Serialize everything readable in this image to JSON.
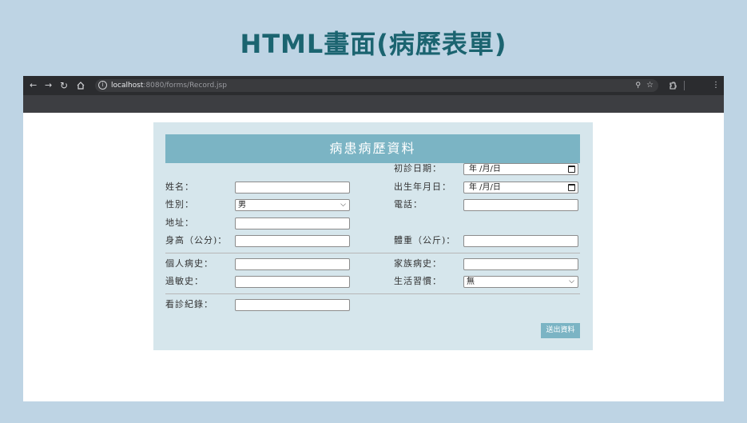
{
  "slide": {
    "title": "HTML畫面(病歷表單)"
  },
  "browser": {
    "url_host": "localhost",
    "url_rest": ":8080/forms/Record.jsp",
    "icons": [
      "back-icon",
      "forward-icon",
      "reload-icon",
      "home-icon",
      "site-info-icon",
      "zoom-icon",
      "star-icon",
      "extensions-icon",
      "menu-icon"
    ]
  },
  "form": {
    "heading": "病患病歷資料",
    "first_visit": {
      "label": "初診日期：",
      "value": "年 /月/日"
    },
    "name": {
      "label": "姓名：",
      "value": ""
    },
    "birth_date": {
      "label": "出生年月日：",
      "value": "年 /月/日"
    },
    "gender": {
      "label": "性別：",
      "value": "男"
    },
    "phone": {
      "label": "電話：",
      "value": ""
    },
    "address": {
      "label": "地址：",
      "value": ""
    },
    "height": {
      "label": "身高（公分)：",
      "value": ""
    },
    "weight": {
      "label": "體重（公斤)：",
      "value": ""
    },
    "personal_history": {
      "label": "個人病史：",
      "value": ""
    },
    "family_history": {
      "label": "家族病史：",
      "value": ""
    },
    "allergy_history": {
      "label": "過敏史：",
      "value": ""
    },
    "lifestyle": {
      "label": "生活習慣：",
      "value": "無"
    },
    "visit_record": {
      "label": "看診紀錄：",
      "value": ""
    },
    "submit_label": "送出資料"
  }
}
